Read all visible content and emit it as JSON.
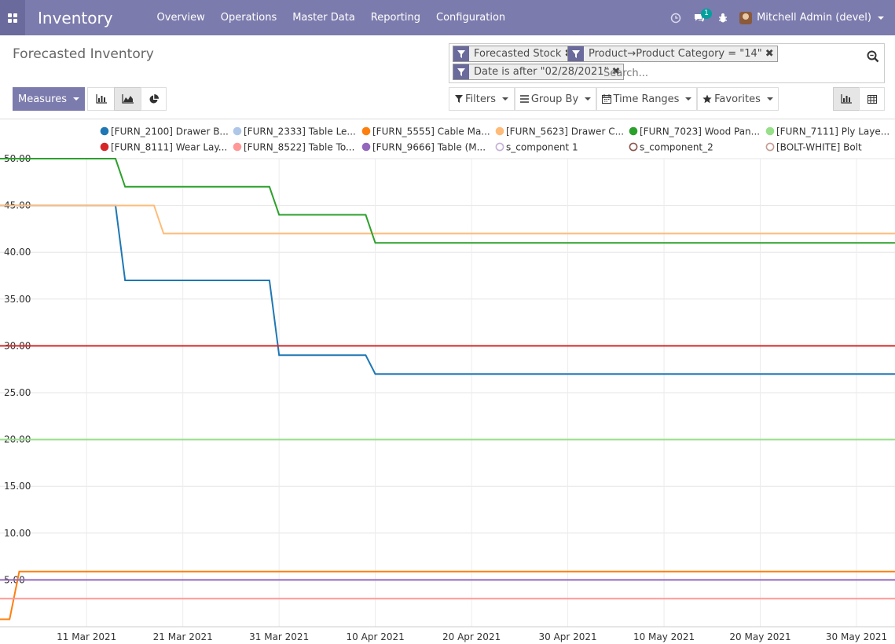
{
  "navbar": {
    "brand": "Inventory",
    "menu": [
      "Overview",
      "Operations",
      "Master Data",
      "Reporting",
      "Configuration"
    ],
    "message_count": "1",
    "user": "Mitchell Admin (devel)"
  },
  "page": {
    "title": "Forecasted Inventory"
  },
  "search": {
    "facets": [
      "Forecasted Stock",
      "Product→Product Category = \"14\"",
      "Date is after \"02/28/2021\""
    ],
    "placeholder": "Search..."
  },
  "toolbar": {
    "measures_label": "Measures",
    "filters_label": "Filters",
    "groupby_label": "Group By",
    "timeranges_label": "Time Ranges",
    "favorites_label": "Favorites"
  },
  "colors": {
    "brand": "#7c7bad",
    "brand_dark": "#6b6a9c"
  },
  "chart_data": {
    "type": "line",
    "title": "",
    "xlabel": "",
    "ylabel": "",
    "ylim": [
      0,
      50
    ],
    "xlim": [
      "2021-03-02",
      "2021-06-03"
    ],
    "y_ticks": [
      "5.00",
      "10.00",
      "15.00",
      "20.00",
      "25.00",
      "30.00",
      "35.00",
      "40.00",
      "45.00",
      "50.00"
    ],
    "x_ticks": [
      {
        "date": "2021-03-11",
        "label": "11 Mar 2021"
      },
      {
        "date": "2021-03-21",
        "label": "21 Mar 2021"
      },
      {
        "date": "2021-03-31",
        "label": "31 Mar 2021"
      },
      {
        "date": "2021-04-10",
        "label": "10 Apr 2021"
      },
      {
        "date": "2021-04-20",
        "label": "20 Apr 2021"
      },
      {
        "date": "2021-04-30",
        "label": "30 Apr 2021"
      },
      {
        "date": "2021-05-10",
        "label": "10 May 2021"
      },
      {
        "date": "2021-05-20",
        "label": "20 May 2021"
      },
      {
        "date": "2021-05-30",
        "label": "30 May 2021"
      }
    ],
    "grid": true,
    "legend_position": "top",
    "series": [
      {
        "name": "[FURN_2100] Drawer B...",
        "color": "#1f77b4",
        "hollow": false,
        "points": [
          [
            "2021-03-02",
            45
          ],
          [
            "2021-03-14",
            45
          ],
          [
            "2021-03-15",
            37
          ],
          [
            "2021-03-30",
            37
          ],
          [
            "2021-03-31",
            29
          ],
          [
            "2021-04-09",
            29
          ],
          [
            "2021-04-10",
            27
          ],
          [
            "2021-06-03",
            27
          ]
        ]
      },
      {
        "name": "[FURN_2333] Table Le...",
        "color": "#aec7e8",
        "hollow": false,
        "points": []
      },
      {
        "name": "[FURN_5555] Cable Ma...",
        "color": "#ff7f0e",
        "hollow": false,
        "points": [
          [
            "2021-03-02",
            0.8
          ],
          [
            "2021-03-03",
            0.8
          ],
          [
            "2021-03-04",
            5.9
          ],
          [
            "2021-06-03",
            5.9
          ]
        ]
      },
      {
        "name": "[FURN_5623] Drawer C...",
        "color": "#ffbb78",
        "hollow": false,
        "points": [
          [
            "2021-03-02",
            45
          ],
          [
            "2021-03-18",
            45
          ],
          [
            "2021-03-19",
            42
          ],
          [
            "2021-06-03",
            42
          ]
        ]
      },
      {
        "name": "[FURN_7023] Wood Pan...",
        "color": "#2ca02c",
        "hollow": false,
        "points": [
          [
            "2021-03-02",
            50
          ],
          [
            "2021-03-14",
            50
          ],
          [
            "2021-03-15",
            47
          ],
          [
            "2021-03-30",
            47
          ],
          [
            "2021-03-31",
            44
          ],
          [
            "2021-04-09",
            44
          ],
          [
            "2021-04-10",
            41
          ],
          [
            "2021-06-03",
            41
          ]
        ]
      },
      {
        "name": "[FURN_7111] Ply Laye...",
        "color": "#98df8a",
        "hollow": false,
        "points": [
          [
            "2021-03-02",
            20
          ],
          [
            "2021-06-03",
            20
          ]
        ]
      },
      {
        "name": "[FURN_8111] Wear Lay...",
        "color": "#d62728",
        "hollow": false,
        "points": [
          [
            "2021-03-02",
            30
          ],
          [
            "2021-06-03",
            30
          ]
        ]
      },
      {
        "name": "[FURN_8522] Table To...",
        "color": "#ff9896",
        "hollow": false,
        "points": [
          [
            "2021-03-02",
            3
          ],
          [
            "2021-06-03",
            3
          ]
        ]
      },
      {
        "name": "[FURN_9666] Table (M...",
        "color": "#9467bd",
        "hollow": false,
        "points": [
          [
            "2021-03-02",
            5
          ],
          [
            "2021-06-03",
            5
          ]
        ]
      },
      {
        "name": "s_component 1",
        "color": "#c5b0d5",
        "hollow": true,
        "points": []
      },
      {
        "name": "s_component_2",
        "color": "#8c564b",
        "hollow": true,
        "points": []
      },
      {
        "name": "[BOLT-WHITE] Bolt",
        "color": "#c49c94",
        "hollow": true,
        "points": []
      }
    ]
  }
}
